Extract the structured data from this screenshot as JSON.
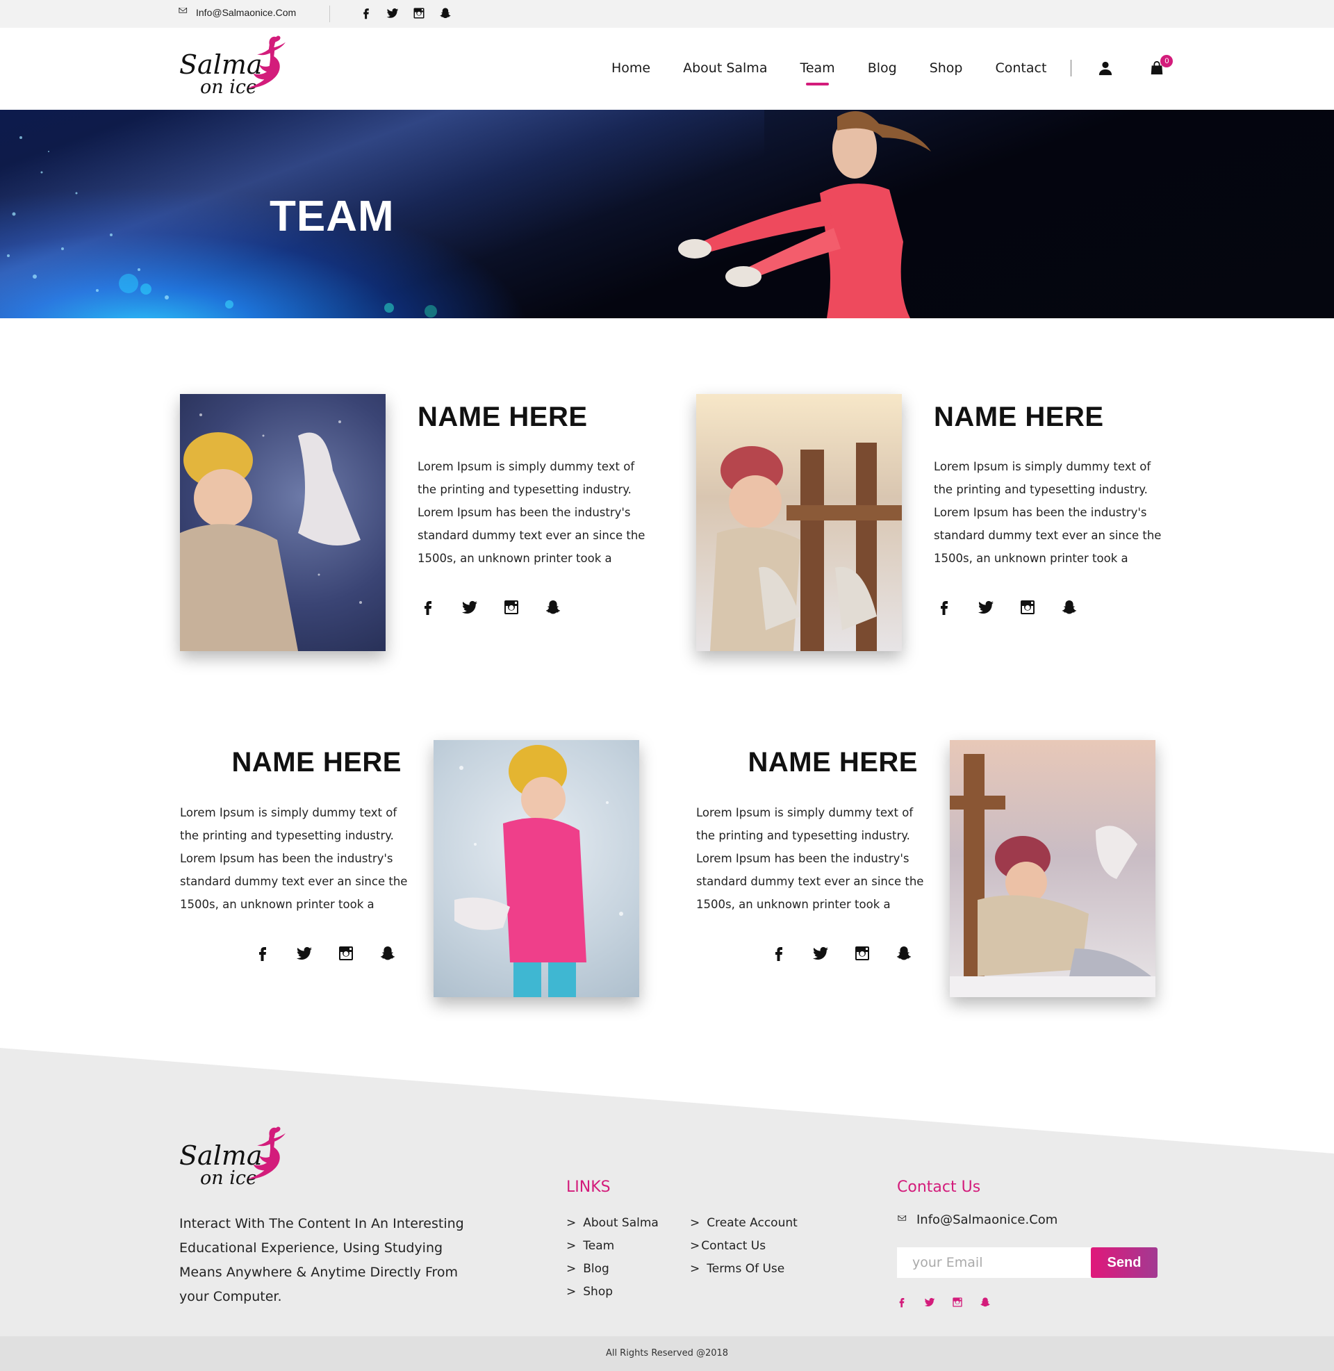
{
  "topbar": {
    "email": "Info@Salmaonice.Com",
    "social_icons": [
      "facebook-icon",
      "twitter-icon",
      "instagram-icon",
      "snapchat-icon"
    ]
  },
  "brand": {
    "line1": "Salma",
    "line2": "on ice",
    "accent": "#d31c7b"
  },
  "nav": {
    "items": [
      {
        "label": "Home"
      },
      {
        "label": "About Salma"
      },
      {
        "label": "Team",
        "active": true
      },
      {
        "label": "Blog"
      },
      {
        "label": "Shop"
      },
      {
        "label": "Contact"
      }
    ],
    "cart_count": "0"
  },
  "hero": {
    "title": "TEAM"
  },
  "team": [
    {
      "name": "NAME HERE",
      "bio": "Lorem Ipsum is simply dummy text of the printing and typesetting industry. Lorem Ipsum has been the industry's standard dummy text ever an since the 1500s, an unknown printer took a"
    },
    {
      "name": "NAME HERE",
      "bio": "Lorem Ipsum is simply dummy text of the printing and typesetting industry. Lorem Ipsum has been the industry's standard dummy text ever an since the 1500s, an unknown printer took a"
    },
    {
      "name": "NAME HERE",
      "bio": "Lorem Ipsum is simply dummy text of the printing and typesetting industry. Lorem Ipsum has been the industry's standard dummy text ever an since the 1500s, an unknown printer took a"
    },
    {
      "name": "NAME HERE",
      "bio": "Lorem Ipsum is simply dummy text of the printing and typesetting industry. Lorem Ipsum has been the industry's standard dummy text ever an since the 1500s, an unknown printer took a"
    }
  ],
  "footer": {
    "description": "Interact With The Content In An Interesting Educational Experience, Using Studying Means Anywhere & Anytime Directly From your Computer.",
    "links_heading": "LINKS",
    "links_col1": [
      "About Salma",
      "Team",
      "Blog",
      "Shop"
    ],
    "links_col2": [
      "Create Account",
      "Contact Us",
      "Terms Of Use"
    ],
    "contact_heading": "Contact Us",
    "contact_email": "Info@Salmaonice.Com",
    "email_placeholder": "your Email",
    "send_label": "Send",
    "copyright": "All Rights Reserved @2018"
  }
}
